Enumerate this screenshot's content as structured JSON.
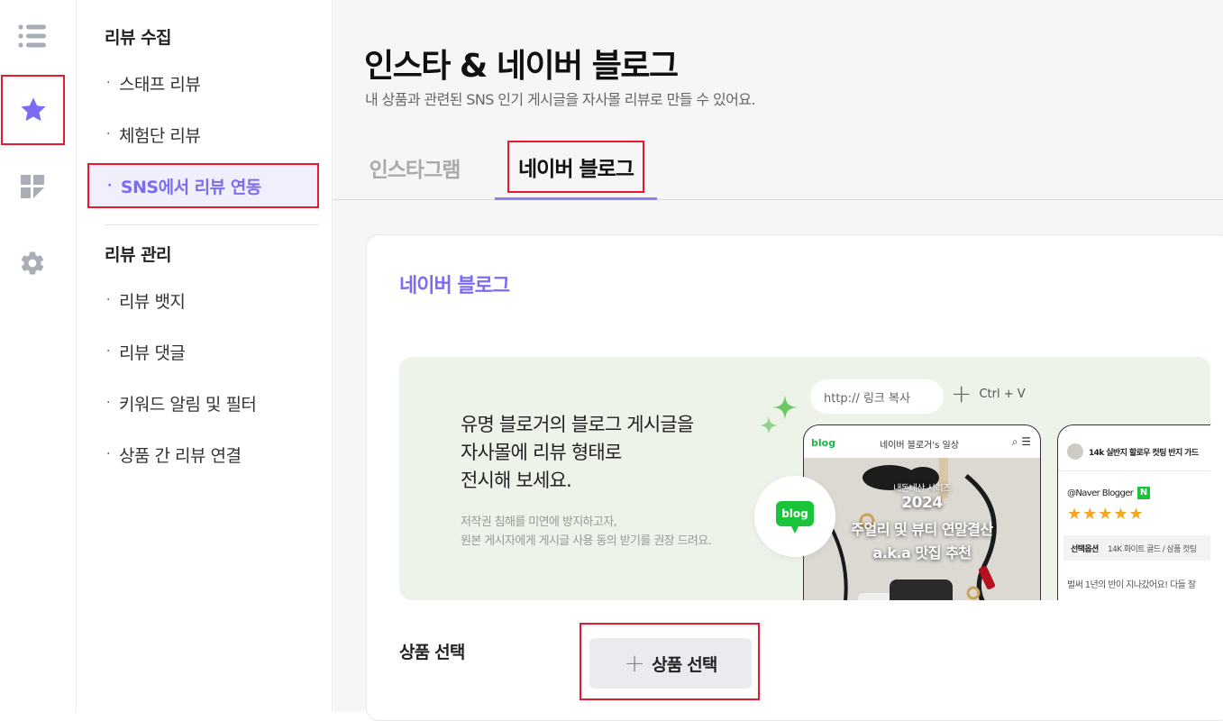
{
  "rail": {
    "items": [
      {
        "icon": "menu-list-icon",
        "active": false
      },
      {
        "icon": "star-icon",
        "active": true
      },
      {
        "icon": "dashboard-icon",
        "active": false
      },
      {
        "icon": "gear-icon",
        "active": false
      }
    ],
    "active_color": "#7b6cf3",
    "icon_color": "#a9adb6"
  },
  "submenu": {
    "collect": {
      "title": "리뷰 수집",
      "items": [
        {
          "label": "스태프 리뷰"
        },
        {
          "label": "체험단 리뷰"
        },
        {
          "label": "SNS에서 리뷰 연동",
          "active": true
        }
      ]
    },
    "manage": {
      "title": "리뷰 관리",
      "items": [
        {
          "label": "리뷰 뱃지"
        },
        {
          "label": "리뷰 댓글"
        },
        {
          "label": "키워드 알림 및 필터"
        },
        {
          "label": "상품 간 리뷰 연결"
        }
      ]
    },
    "bullet": "·"
  },
  "page": {
    "title": "인스타 & 네이버 블로그",
    "subtitle": "내 상품과 관련된 SNS 인기 게시글을 자사몰 리뷰로 만들 수 있어요.",
    "tabs": [
      {
        "label": "인스타그램",
        "active": false
      },
      {
        "label": "네이버 블로그",
        "active": true
      }
    ]
  },
  "card": {
    "title": "네이버 블로그",
    "banner": {
      "headline": [
        "유명 블로거의 블로그 게시글을",
        "자사몰에 리뷰 형태로",
        "전시해 보세요."
      ],
      "note": [
        "저작권 침해를 미연에 방지하고자,",
        "원본 게시자에게 게시글 사용 동의 받기를 권장 드려요."
      ],
      "url_placeholder": "http:// 링크 복사",
      "shortcut": "Ctrl + V",
      "blog_badge": "blog",
      "phone1": {
        "logo": "blog",
        "blog_name": "네이버 블로거's 일상",
        "series": "내돈내산 시리즈",
        "year": "2024",
        "line1": "주얼리 및 뷰티 연말결산",
        "line2": "a.k.a 맛집 추천"
      },
      "phone2": {
        "product": "14k 실반지 할로우 컷팅 반지 가드",
        "author": "@Naver Blogger",
        "stars": "★★★★★",
        "option_label": "선택옵션",
        "option_value": "14K 화이트 골드 / 삼품 컷팅",
        "body": "벌써 1년의 반이 지나갔어요! 다들 잘"
      }
    },
    "product_select": {
      "label": "상품 선택",
      "button": "상품 선택",
      "plus": "+"
    }
  }
}
